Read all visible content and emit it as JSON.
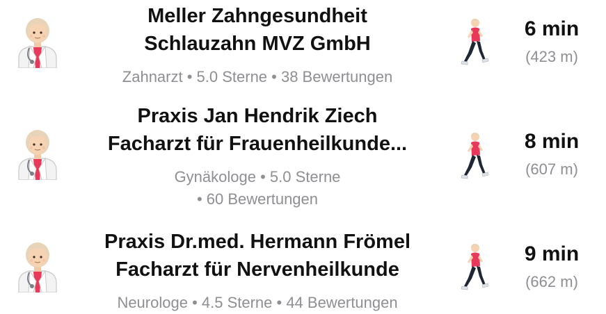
{
  "results": [
    {
      "title_lines": [
        "Meller Zahngesundheit",
        "Schlauzahn MVZ GmbH"
      ],
      "subtitle_lines": [
        "Zahnarzt • 5.0 Sterne • 38 Bewertungen"
      ],
      "category_icon": "health-worker-icon",
      "travel_icon": "person-walking-icon",
      "eta_time": "6 min",
      "eta_distance": "(423 m)"
    },
    {
      "title_lines": [
        "Praxis Jan Hendrik Ziech",
        "Facharzt für Frauenheilkunde..."
      ],
      "subtitle_lines": [
        "Gynäkologe • 5.0 Sterne",
        "• 60 Bewertungen"
      ],
      "category_icon": "health-worker-icon",
      "travel_icon": "person-walking-icon",
      "eta_time": "8 min",
      "eta_distance": "(607 m)"
    },
    {
      "title_lines": [
        "Praxis Dr.med. Hermann Frömel",
        "Facharzt für Nervenheilkunde"
      ],
      "subtitle_lines": [
        "Neurologe • 4.5 Sterne • 44 Bewertungen"
      ],
      "category_icon": "health-worker-icon",
      "travel_icon": "person-walking-icon",
      "eta_time": "9 min",
      "eta_distance": "(662 m)"
    }
  ],
  "colors": {
    "title": "#111111",
    "secondary": "#8e8e93",
    "background": "#ffffff"
  }
}
